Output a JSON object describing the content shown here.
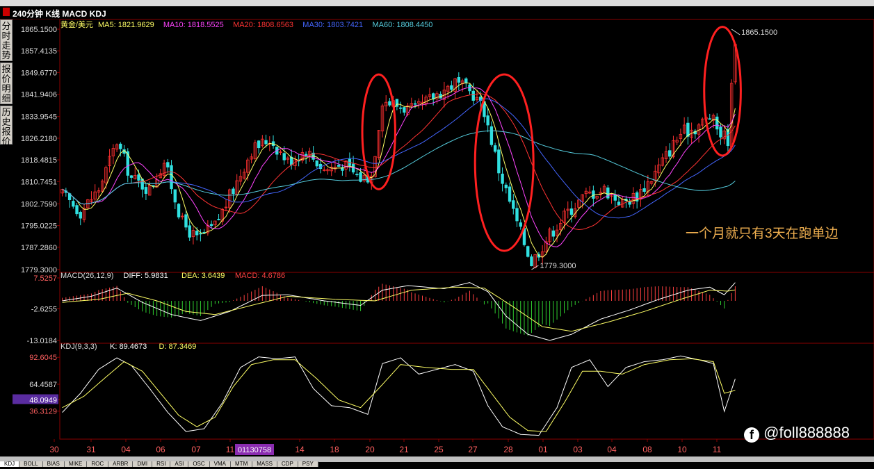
{
  "window": {
    "title": "240分钟 K线 MACD KDJ"
  },
  "side_tabs": [
    "分时走势",
    "报价明细",
    "历史报价"
  ],
  "bottom_tabs": [
    "KDJ",
    "BOLL",
    "BIAS",
    "MIKE",
    "ROC",
    "ARBR",
    "DMI",
    "RSI",
    "ASI",
    "OSC",
    "VMA",
    "MTM",
    "MASS",
    "CDP",
    "PSY"
  ],
  "watermark": "@foll888888",
  "chart_data": {
    "type": "candlestick",
    "symbol": "黄金/美元",
    "annotation": "一个月就只有3天在跑单边",
    "high_label": "1865.1500",
    "low_label": "1779.3000",
    "cursor_label": "01130758",
    "x_ticks": [
      "30",
      "31",
      "04",
      "06",
      "07",
      "11",
      "14",
      "18",
      "20",
      "21",
      "25",
      "27",
      "28",
      "01",
      "03",
      "04",
      "08",
      "10",
      "11"
    ],
    "price_panel": {
      "y_ticks": [
        "1865.1500",
        "1857.4135",
        "1849.6770",
        "1841.9406",
        "1833.9545",
        "1826.2180",
        "1818.4815",
        "1810.7451",
        "1802.7590",
        "1795.0225",
        "1787.2860",
        "1779.3000"
      ],
      "ylim": [
        1779.3,
        1865.15
      ],
      "legend": [
        {
          "name": "MA5:",
          "value": "1821.9629",
          "color": "#ffff66"
        },
        {
          "name": "MA10:",
          "value": "1818.5525",
          "color": "#ff44ff"
        },
        {
          "name": "MA20:",
          "value": "1808.6563",
          "color": "#ff3333"
        },
        {
          "name": "MA30:",
          "value": "1803.7421",
          "color": "#4466ff"
        },
        {
          "name": "MA60:",
          "value": "1808.4450",
          "color": "#55ccdd"
        }
      ],
      "anchors": [
        [
          0,
          1806
        ],
        [
          5,
          1800
        ],
        [
          10,
          1808
        ],
        [
          15,
          1825
        ],
        [
          19,
          1812
        ],
        [
          24,
          1808
        ],
        [
          28,
          1818
        ],
        [
          33,
          1796
        ],
        [
          37,
          1790
        ],
        [
          42,
          1795
        ],
        [
          47,
          1808
        ],
        [
          52,
          1822
        ],
        [
          57,
          1826
        ],
        [
          62,
          1818
        ],
        [
          67,
          1822
        ],
        [
          72,
          1815
        ],
        [
          77,
          1817
        ],
        [
          82,
          1812
        ],
        [
          85,
          1813
        ],
        [
          88,
          1840
        ],
        [
          92,
          1838
        ],
        [
          97,
          1836
        ],
        [
          103,
          1842
        ],
        [
          108,
          1846
        ],
        [
          113,
          1842
        ],
        [
          116,
          1836
        ],
        [
          120,
          1815
        ],
        [
          125,
          1796
        ],
        [
          129,
          1782
        ],
        [
          134,
          1792
        ],
        [
          139,
          1800
        ],
        [
          144,
          1806
        ],
        [
          149,
          1808
        ],
        [
          154,
          1803
        ],
        [
          158,
          1806
        ],
        [
          162,
          1812
        ],
        [
          166,
          1820
        ],
        [
          170,
          1828
        ],
        [
          174,
          1830
        ],
        [
          178,
          1834
        ],
        [
          181,
          1828
        ],
        [
          183,
          1826
        ],
        [
          185,
          1862
        ]
      ],
      "ovals": [
        {
          "start": 84,
          "end": 90,
          "top": 1849,
          "bottom": 1808
        },
        {
          "start": 115,
          "end": 128,
          "top": 1849,
          "bottom": 1786
        },
        {
          "start": 178,
          "end": 185,
          "top": 1866,
          "bottom": 1820
        }
      ]
    },
    "macd_panel": {
      "title": "MACD(26,12,9)",
      "legend": [
        {
          "name": "DIFF:",
          "value": "5.9831",
          "color": "#ffffff"
        },
        {
          "name": "DEA:",
          "value": "3.6439",
          "color": "#ffff66"
        },
        {
          "name": "MACD:",
          "value": "4.6786",
          "color": "#ff4444"
        }
      ],
      "y_ticks": [
        "7.5257",
        "-2.6255",
        "-13.0184"
      ],
      "ylim": [
        -13.0184,
        7.5257
      ],
      "diff_anchors": [
        [
          0,
          0
        ],
        [
          8,
          1.5
        ],
        [
          15,
          4.2
        ],
        [
          22,
          -0.5
        ],
        [
          30,
          -4.5
        ],
        [
          38,
          -6.5
        ],
        [
          46,
          -3.5
        ],
        [
          55,
          1.8
        ],
        [
          62,
          2
        ],
        [
          72,
          0
        ],
        [
          82,
          -1.5
        ],
        [
          88,
          3.5
        ],
        [
          95,
          5
        ],
        [
          105,
          4
        ],
        [
          112,
          6
        ],
        [
          117,
          3
        ],
        [
          122,
          -5
        ],
        [
          128,
          -11
        ],
        [
          134,
          -13
        ],
        [
          140,
          -11
        ],
        [
          148,
          -6
        ],
        [
          156,
          -3
        ],
        [
          164,
          0.5
        ],
        [
          172,
          3.5
        ],
        [
          178,
          4.5
        ],
        [
          182,
          2
        ],
        [
          185,
          6
        ]
      ],
      "dea_anchors": [
        [
          0,
          -0.5
        ],
        [
          10,
          0.5
        ],
        [
          18,
          2.5
        ],
        [
          26,
          0
        ],
        [
          34,
          -3.5
        ],
        [
          42,
          -4.5
        ],
        [
          52,
          -1.5
        ],
        [
          62,
          1.5
        ],
        [
          75,
          0.5
        ],
        [
          86,
          0
        ],
        [
          96,
          3.5
        ],
        [
          108,
          4.5
        ],
        [
          116,
          4.2
        ],
        [
          124,
          -2
        ],
        [
          132,
          -8.5
        ],
        [
          140,
          -10
        ],
        [
          150,
          -7
        ],
        [
          160,
          -3.5
        ],
        [
          170,
          0.5
        ],
        [
          178,
          3.5
        ],
        [
          183,
          3.2
        ],
        [
          185,
          3.6
        ]
      ]
    },
    "kdj_panel": {
      "title": "KDJ(9,3,3)",
      "legend": [
        {
          "name": "K:",
          "value": "89.4673",
          "color": "#ffffff"
        },
        {
          "name": "D:",
          "value": "87.3469",
          "color": "#ffff66"
        }
      ],
      "y_ticks": [
        "92.6045",
        "64.4587",
        "48.0949",
        "36.3129"
      ],
      "ylim": [
        10,
        100
      ],
      "k_anchors": [
        [
          0,
          35
        ],
        [
          5,
          55
        ],
        [
          10,
          80
        ],
        [
          15,
          92
        ],
        [
          19,
          84
        ],
        [
          24,
          60
        ],
        [
          29,
          35
        ],
        [
          34,
          15
        ],
        [
          39,
          18
        ],
        [
          44,
          45
        ],
        [
          49,
          82
        ],
        [
          54,
          93
        ],
        [
          59,
          91
        ],
        [
          64,
          93
        ],
        [
          69,
          60
        ],
        [
          74,
          42
        ],
        [
          79,
          40
        ],
        [
          84,
          33
        ],
        [
          88,
          86
        ],
        [
          93,
          92
        ],
        [
          98,
          75
        ],
        [
          103,
          80
        ],
        [
          108,
          85
        ],
        [
          113,
          78
        ],
        [
          117,
          42
        ],
        [
          121,
          20
        ],
        [
          126,
          12
        ],
        [
          131,
          11
        ],
        [
          136,
          40
        ],
        [
          140,
          82
        ],
        [
          145,
          90
        ],
        [
          150,
          62
        ],
        [
          155,
          82
        ],
        [
          160,
          88
        ],
        [
          165,
          90
        ],
        [
          170,
          94
        ],
        [
          175,
          90
        ],
        [
          179,
          86
        ],
        [
          182,
          36
        ],
        [
          185,
          70
        ]
      ],
      "d_anchors": [
        [
          0,
          40
        ],
        [
          6,
          52
        ],
        [
          12,
          72
        ],
        [
          17,
          88
        ],
        [
          22,
          78
        ],
        [
          27,
          55
        ],
        [
          32,
          32
        ],
        [
          37,
          20
        ],
        [
          42,
          30
        ],
        [
          47,
          62
        ],
        [
          52,
          85
        ],
        [
          58,
          90
        ],
        [
          64,
          90
        ],
        [
          70,
          70
        ],
        [
          76,
          48
        ],
        [
          82,
          40
        ],
        [
          87,
          60
        ],
        [
          93,
          85
        ],
        [
          100,
          82
        ],
        [
          107,
          80
        ],
        [
          113,
          80
        ],
        [
          118,
          55
        ],
        [
          123,
          30
        ],
        [
          128,
          16
        ],
        [
          133,
          15
        ],
        [
          138,
          45
        ],
        [
          143,
          78
        ],
        [
          148,
          78
        ],
        [
          154,
          75
        ],
        [
          160,
          85
        ],
        [
          167,
          90
        ],
        [
          173,
          91
        ],
        [
          179,
          88
        ],
        [
          182,
          55
        ],
        [
          185,
          58
        ]
      ]
    }
  }
}
